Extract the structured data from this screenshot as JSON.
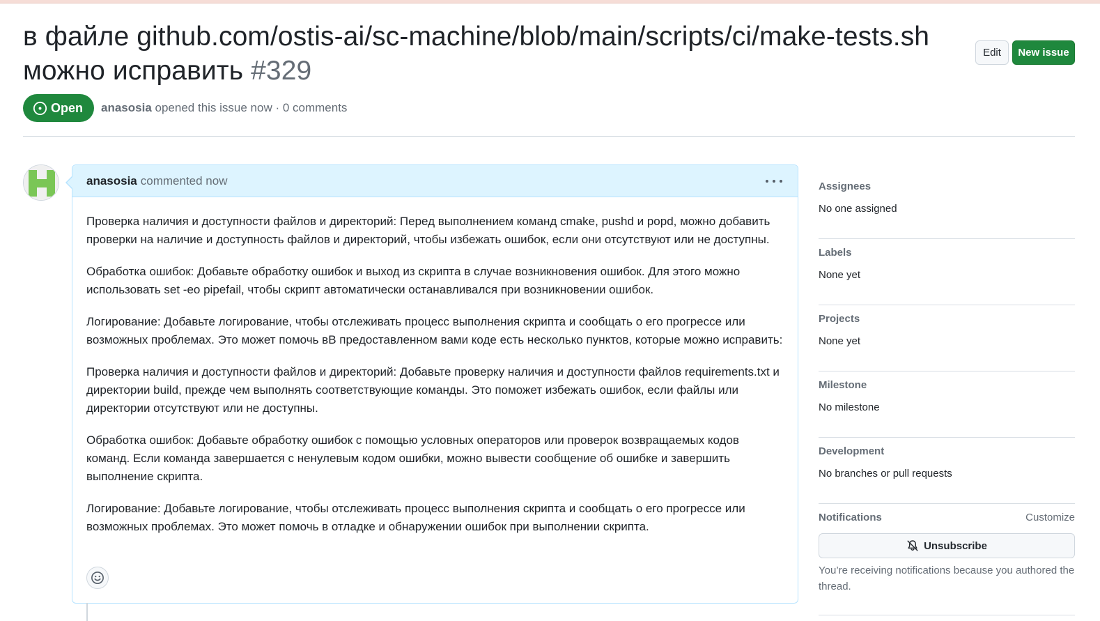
{
  "issue": {
    "title": "в файле github.com/ostis-ai/sc-machine/blob/main/scripts/ci/make-tests.sh можно исправить",
    "number": "#329",
    "state": "Open",
    "author": "anasosia",
    "meta": "opened this issue now · 0 comments"
  },
  "header": {
    "edit_label": "Edit",
    "new_issue_label": "New issue"
  },
  "comment": {
    "author": "anasosia",
    "action": "commented now",
    "paragraphs": [
      "Проверка наличия и доступности файлов и директорий: Перед выполнением команд cmake, pushd и popd, можно добавить проверки на наличие и доступность файлов и директорий, чтобы избежать ошибок, если они отсутствуют или не доступны.",
      "Обработка ошибок: Добавьте обработку ошибок и выход из скрипта в случае возникновения ошибок. Для этого можно использовать set -eo pipefail, чтобы скрипт автоматически останавливался при возникновении ошибок.",
      "Логирование: Добавьте логирование, чтобы отслеживать процесс выполнения скрипта и сообщать о его прогрессе или возможных проблемах. Это может помочь вВ предоставленном вами коде есть несколько пунктов, которые можно исправить:",
      "Проверка наличия и доступности файлов и директорий: Добавьте проверку наличия и доступности файлов requirements.txt и директории build, прежде чем выполнять соответствующие команды. Это поможет избежать ошибок, если файлы или директории отсутствуют или не доступны.",
      "Обработка ошибок: Добавьте обработку ошибок с помощью условных операторов или проверок возвращаемых кодов команд. Если команда завершается с ненулевым кодом ошибки, можно вывести сообщение об ошибке и завершить выполнение скрипта.",
      "Логирование: Добавьте логирование, чтобы отслеживать процесс выполнения скрипта и сообщать о его прогрессе или возможных проблемах. Это может помочь в отладке и обнаружении ошибок при выполнении скрипта."
    ]
  },
  "sidebar": {
    "assignees": {
      "heading": "Assignees",
      "value": "No one assigned"
    },
    "labels": {
      "heading": "Labels",
      "value": "None yet"
    },
    "projects": {
      "heading": "Projects",
      "value": "None yet"
    },
    "milestone": {
      "heading": "Milestone",
      "value": "No milestone"
    },
    "development": {
      "heading": "Development",
      "value": "No branches or pull requests"
    },
    "notifications": {
      "heading": "Notifications",
      "customize_label": "Customize",
      "unsubscribe_label": "Unsubscribe",
      "note": "You’re receiving notifications because you authored the thread."
    }
  },
  "icons": {
    "open": "issue-opened-icon",
    "kebab": "kebab-horizontal-icon",
    "reaction": "smiley-icon",
    "unsubscribe": "bell-slash-icon",
    "avatar": "identicon-avatar"
  },
  "colors": {
    "open_green": "#1f883d",
    "comment_header_bg": "#ddf4ff",
    "comment_border": "#b6e3ff",
    "muted_text": "#656d76",
    "avatar_green": "#7ac656"
  }
}
